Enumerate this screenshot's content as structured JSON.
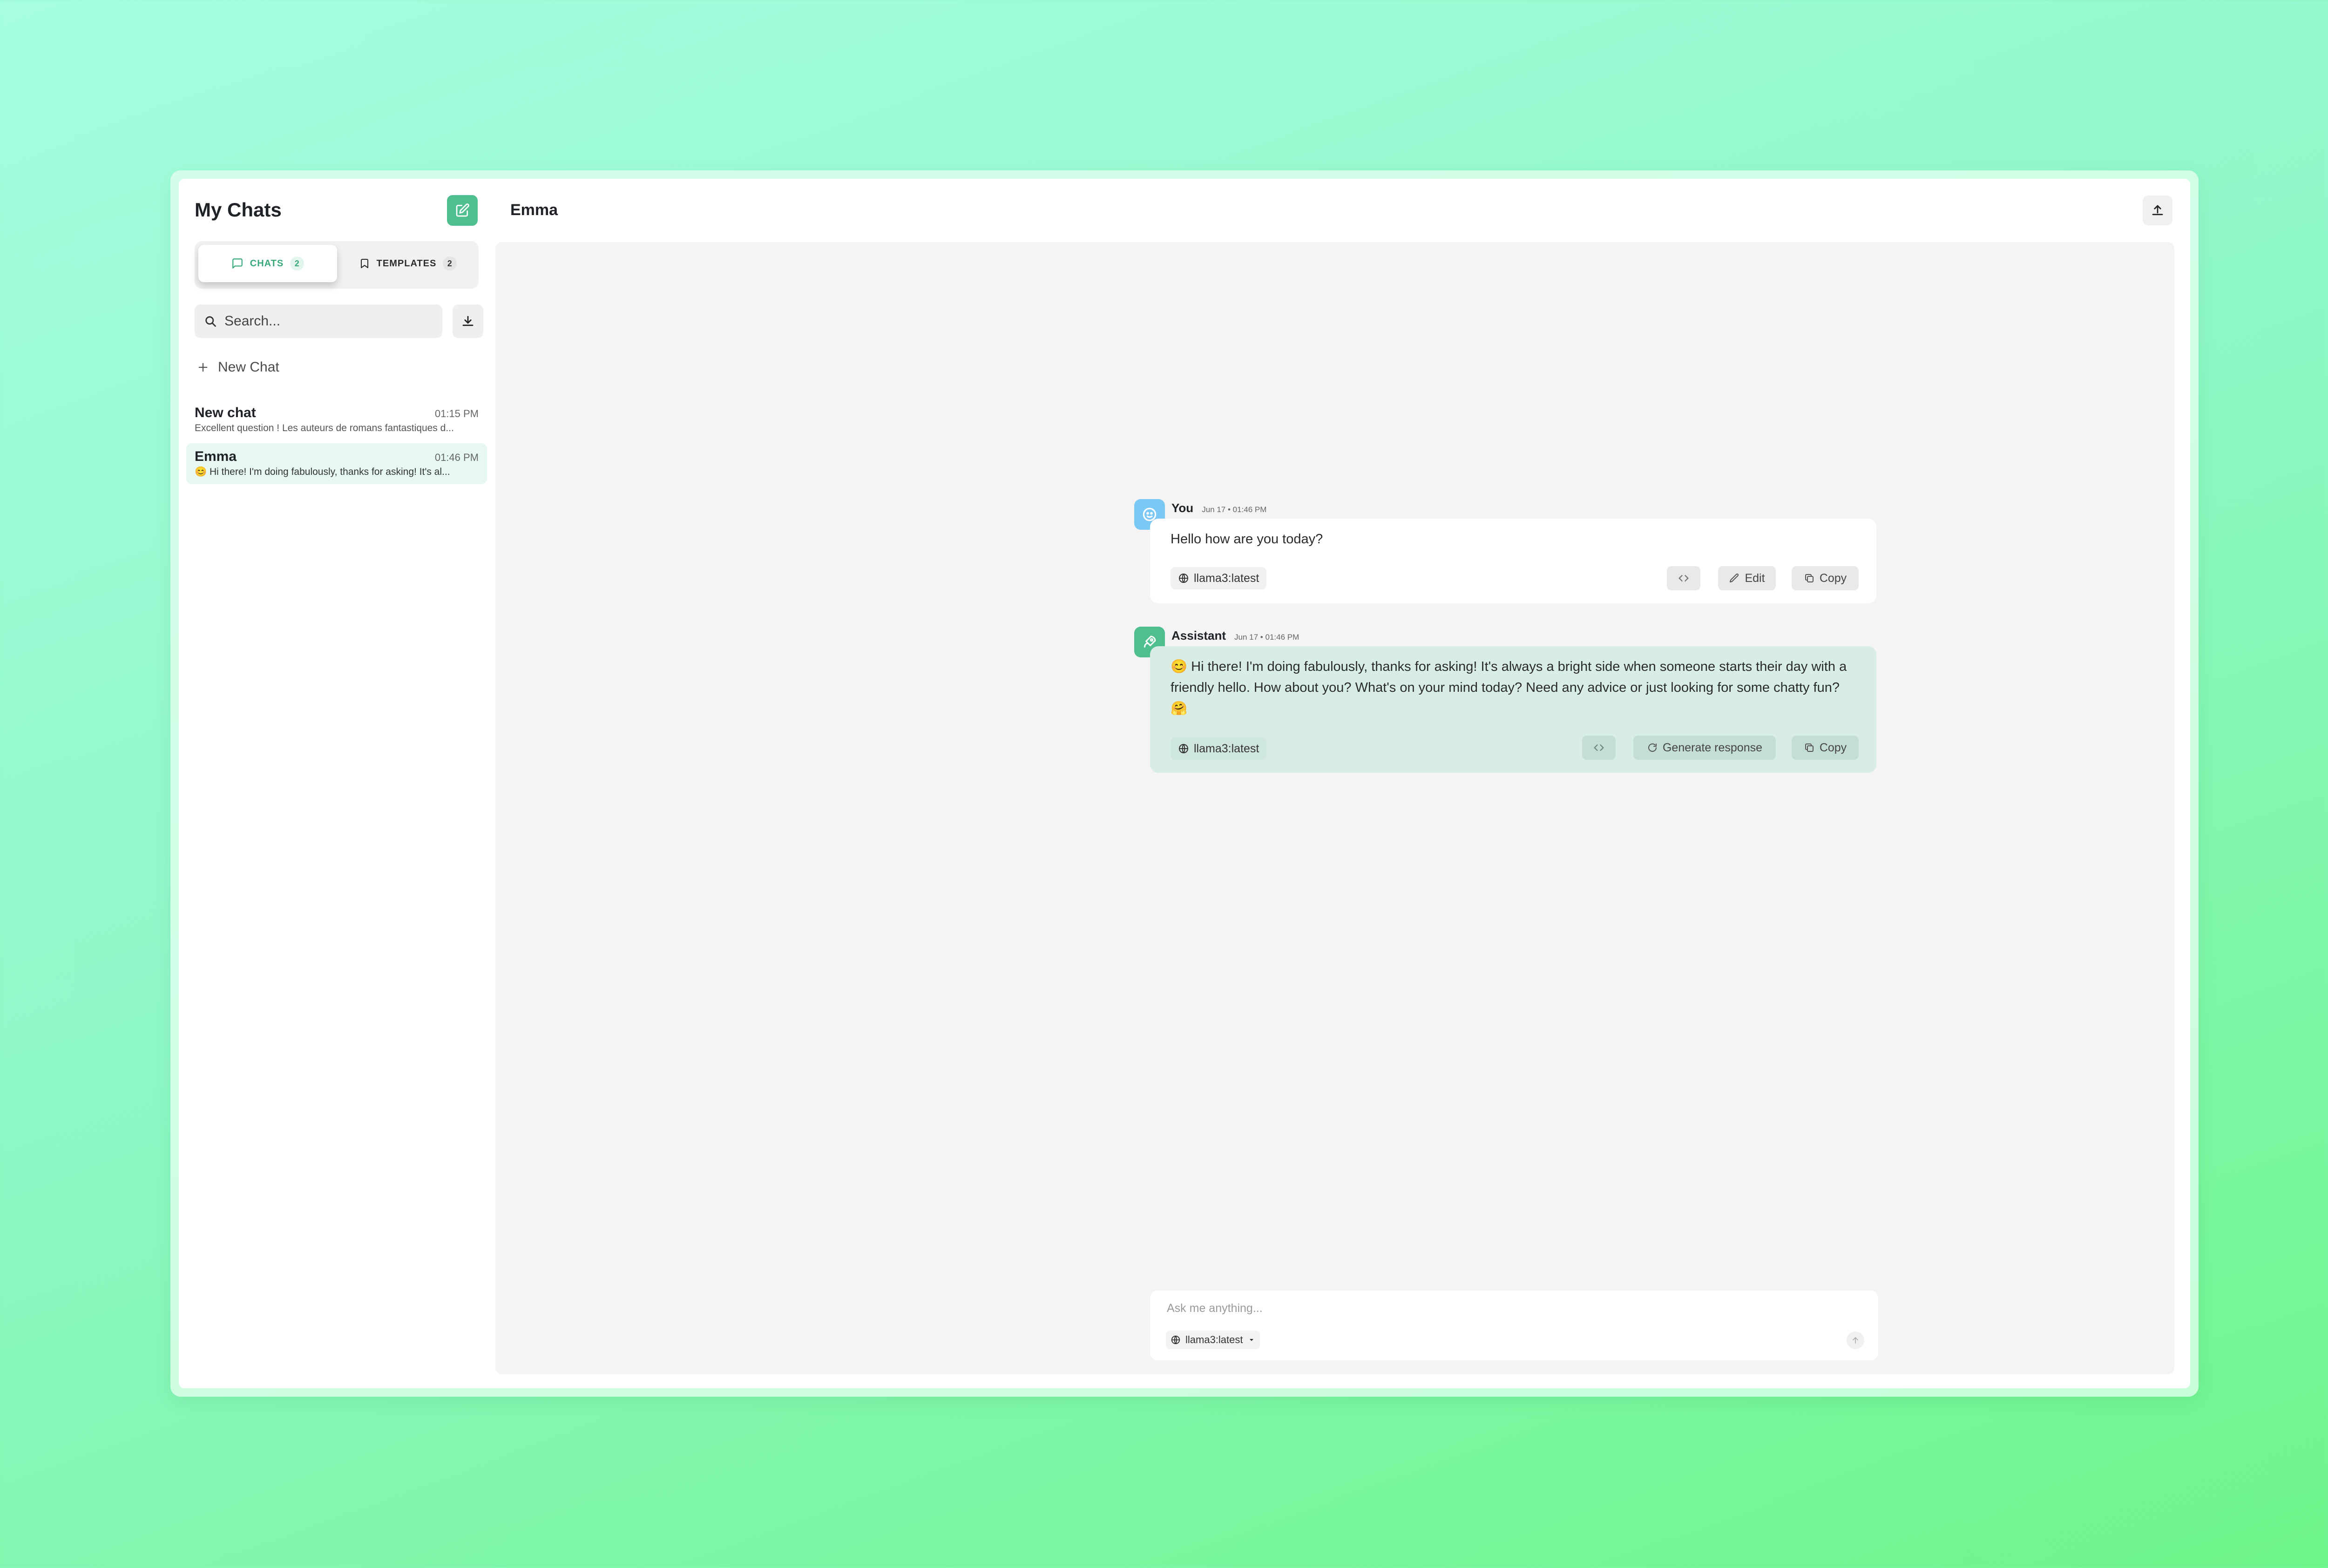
{
  "sidebar": {
    "title": "My Chats",
    "tabs": [
      {
        "label": "CHATS",
        "count": "2"
      },
      {
        "label": "TEMPLATES",
        "count": "2"
      }
    ],
    "search_placeholder": "Search...",
    "new_chat_label": "New Chat",
    "chats": [
      {
        "name": "New chat",
        "time": "01:15 PM",
        "preview": "Excellent question ! Les auteurs de romans fantastiques d..."
      },
      {
        "name": "Emma",
        "time": "01:46 PM",
        "preview": "😊 Hi there! I'm doing fabulously, thanks for asking! It's al..."
      }
    ]
  },
  "header": {
    "title": "Emma"
  },
  "messages": [
    {
      "author": "You",
      "time": "Jun 17 • 01:46 PM",
      "text": "Hello how are you today?",
      "model": "llama3:latest",
      "actions": {
        "edit": "Edit",
        "copy": "Copy"
      }
    },
    {
      "author": "Assistant",
      "time": "Jun 17 • 01:46 PM",
      "text": "😊 Hi there! I'm doing fabulously, thanks for asking! It's always a bright side when someone starts their day with a friendly hello. How about you? What's on your mind today? Need any advice or just looking for some chatty fun? 🤗",
      "model": "llama3:latest",
      "actions": {
        "regenerate": "Generate response",
        "copy": "Copy"
      }
    }
  ],
  "composer": {
    "placeholder": "Ask me anything...",
    "model": "llama3:latest"
  },
  "colors": {
    "accent": "#4fbf8f",
    "user_avatar": "#7cc8f5",
    "assistant_bubble": "#d8ede6"
  }
}
